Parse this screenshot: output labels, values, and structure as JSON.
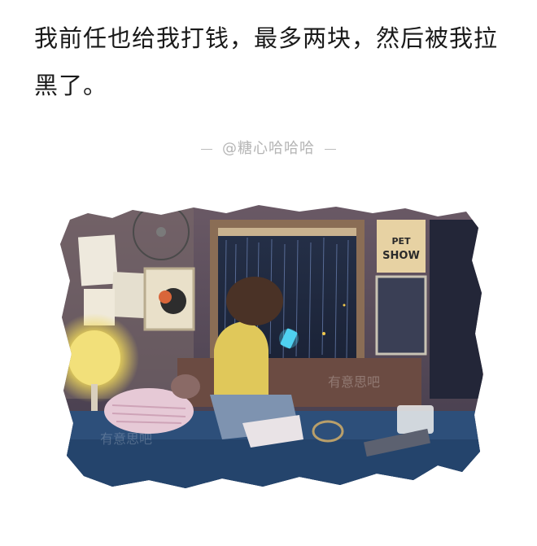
{
  "post": {
    "text": "我前任也给我打钱，最多两块，然后被我拉黑了。"
  },
  "author": {
    "handle": "@糖心哈哈哈"
  },
  "illustration": {
    "poster_line1": "PET",
    "poster_line2": "SHOW",
    "watermark": "有意思吧"
  }
}
